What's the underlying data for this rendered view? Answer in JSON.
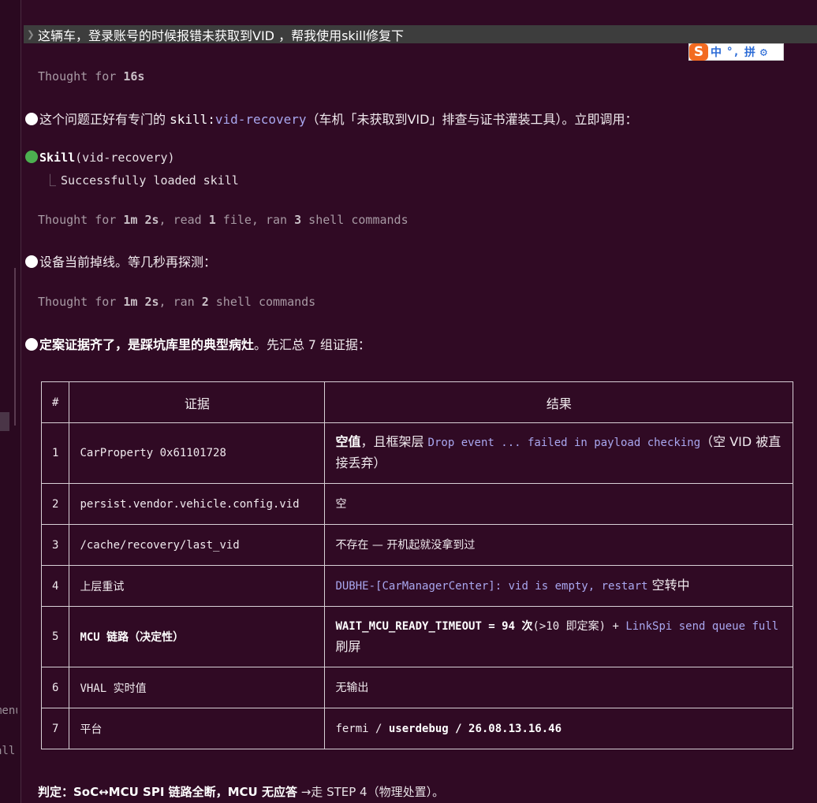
{
  "gutter": {
    "menu_fragment": "menu",
    "all_fragment": "all"
  },
  "prompt": {
    "chevron": "❯",
    "text": "这辆车，登录账号的时候报错未获取到VID ，帮我使用skill修复下"
  },
  "ime": {
    "logo": "S",
    "items": [
      "中",
      "°,",
      "拼"
    ],
    "gear": "⚙"
  },
  "thought1": {
    "prefix": "Thought for ",
    "duration": "16s"
  },
  "msg1": {
    "text1": "这个问题正好有专门的 ",
    "skill_prefix": "skill:",
    "skill_name": "vid-recovery",
    "text2": "（车机「未获取到VID」排查与证书灌装工具）。立即调用："
  },
  "skill_call": {
    "name": "Skill",
    "arg": "(vid-recovery)",
    "tree": "⎿",
    "result": "Successfully loaded skill"
  },
  "thought2": {
    "prefix": "Thought for ",
    "duration": "1m 2s",
    "mid1": ", read ",
    "files": "1",
    "mid2": " file, ran ",
    "cmds": "3",
    "suffix": " shell commands"
  },
  "msg2": {
    "text": "设备当前掉线。等几秒再探测："
  },
  "thought3": {
    "prefix": "Thought for ",
    "duration": "1m 2s",
    "mid": ", ran ",
    "cmds": "2",
    "suffix": " shell commands"
  },
  "msg3": {
    "bold": "定案证据齐了，是踩坑库里的典型病灶",
    "text1": "。先汇总 ",
    "count": "7",
    "text2": " 组证据："
  },
  "table": {
    "headers": [
      "#",
      "证据",
      "结果"
    ],
    "rows": [
      {
        "num": "1",
        "evidence": "CarProperty 0x61101728",
        "r_bold": "空值",
        "r_t1": "，且框架层 ",
        "r_purple": "Drop event ... failed in payload checking",
        "r_t2": "（空 VID 被直接丢弃）"
      },
      {
        "num": "2",
        "evidence": "persist.vendor.vehicle.config.vid",
        "result": "空"
      },
      {
        "num": "3",
        "evidence": "/cache/recovery/last_vid",
        "result": "不存在 — 开机起就没拿到过"
      },
      {
        "num": "4",
        "evidence": "上层重试",
        "r_purple": "DUBHE-[CarManagerCenter]: vid is empty, restart",
        "r_t1": " 空转中"
      },
      {
        "num": "5",
        "evidence": "MCU 链路（决定性）",
        "r_bold": "WAIT_MCU_READY_TIMEOUT = 94 次",
        "r_t1": "(>10 即定案) + ",
        "r_purple": "LinkSpi send queue full",
        "r_t2": " 刷屏"
      },
      {
        "num": "6",
        "evidence": "VHAL 实时值",
        "result": "无输出"
      },
      {
        "num": "7",
        "evidence": "平台",
        "r_t1": "fermi / ",
        "r_bold": "userdebug / 26.08.13.16.46"
      }
    ]
  },
  "verdict": {
    "bold": "判定：SoC↔MCU SPI 链路全断，MCU 无应答",
    "text": " →走 STEP 4（物理处置）。"
  }
}
